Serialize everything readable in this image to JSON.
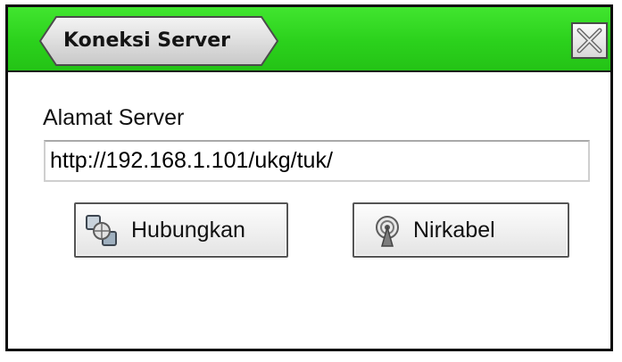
{
  "window": {
    "title": "Koneksi Server",
    "close_icon": "close-icon",
    "title_color": "#2bd11c"
  },
  "form": {
    "address_label": "Alamat Server",
    "address_value": "http://192.168.1.101/ukg/tuk/"
  },
  "buttons": {
    "connect": {
      "label": "Hubungkan",
      "icon": "network-icon"
    },
    "wireless": {
      "label": "Nirkabel",
      "icon": "wireless-antenna-icon"
    }
  }
}
